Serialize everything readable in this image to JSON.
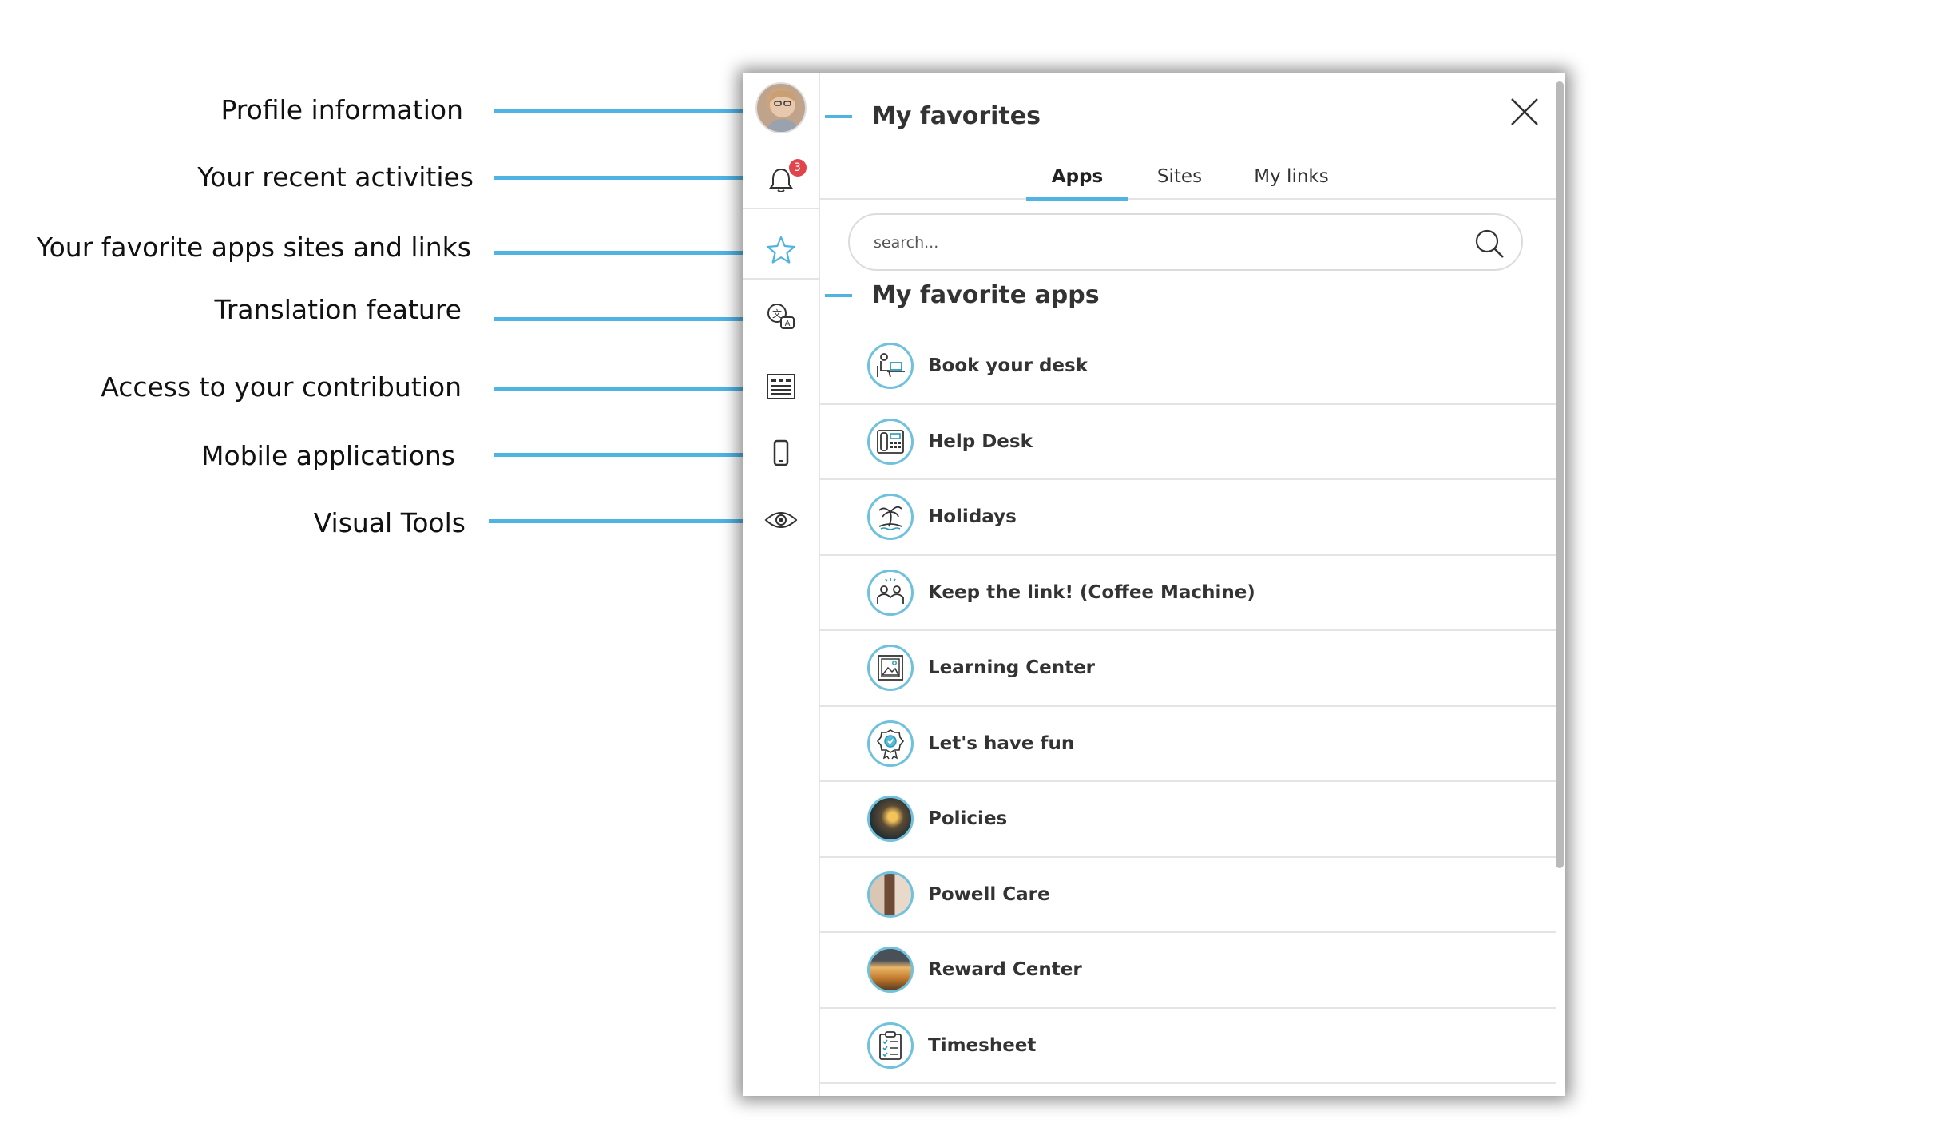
{
  "callouts": [
    {
      "label": "Profile information"
    },
    {
      "label": "Your recent activities"
    },
    {
      "label": "Your favorite apps sites and links"
    },
    {
      "label": "Translation feature"
    },
    {
      "label": "Access to your contribution"
    },
    {
      "label": "Mobile applications"
    },
    {
      "label": "Visual Tools"
    }
  ],
  "rail": {
    "items": [
      {
        "icon": "profile-avatar"
      },
      {
        "icon": "bell-icon",
        "badge": "3"
      },
      {
        "icon": "star-icon"
      },
      {
        "icon": "translate-icon"
      },
      {
        "icon": "contribution-icon"
      },
      {
        "icon": "mobile-icon"
      },
      {
        "icon": "eye-icon"
      }
    ]
  },
  "panel": {
    "title": "My favorites",
    "tabs": [
      {
        "label": "Apps",
        "active": true
      },
      {
        "label": "Sites",
        "active": false
      },
      {
        "label": "My links",
        "active": false
      }
    ],
    "search": {
      "placeholder": "search...",
      "value": ""
    },
    "section_title": "My favorite apps",
    "apps": [
      {
        "label": "Book your desk",
        "icon": "desk-icon"
      },
      {
        "label": "Help Desk",
        "icon": "phone-icon"
      },
      {
        "label": "Holidays",
        "icon": "palm-tree-icon"
      },
      {
        "label": "Keep the link! (Coffee Machine)",
        "icon": "people-icon"
      },
      {
        "label": "Learning Center",
        "icon": "picture-icon"
      },
      {
        "label": "Let's have fun",
        "icon": "award-icon"
      },
      {
        "label": "Policies",
        "icon": "photo-policies"
      },
      {
        "label": "Powell Care",
        "icon": "photo-care"
      },
      {
        "label": "Reward Center",
        "icon": "photo-reward"
      },
      {
        "label": "Timesheet",
        "icon": "clipboard-icon"
      }
    ]
  },
  "colors": {
    "accent": "#4fb3e3",
    "icon_ring": "#6fc1dd",
    "badge": "#e0454b"
  }
}
